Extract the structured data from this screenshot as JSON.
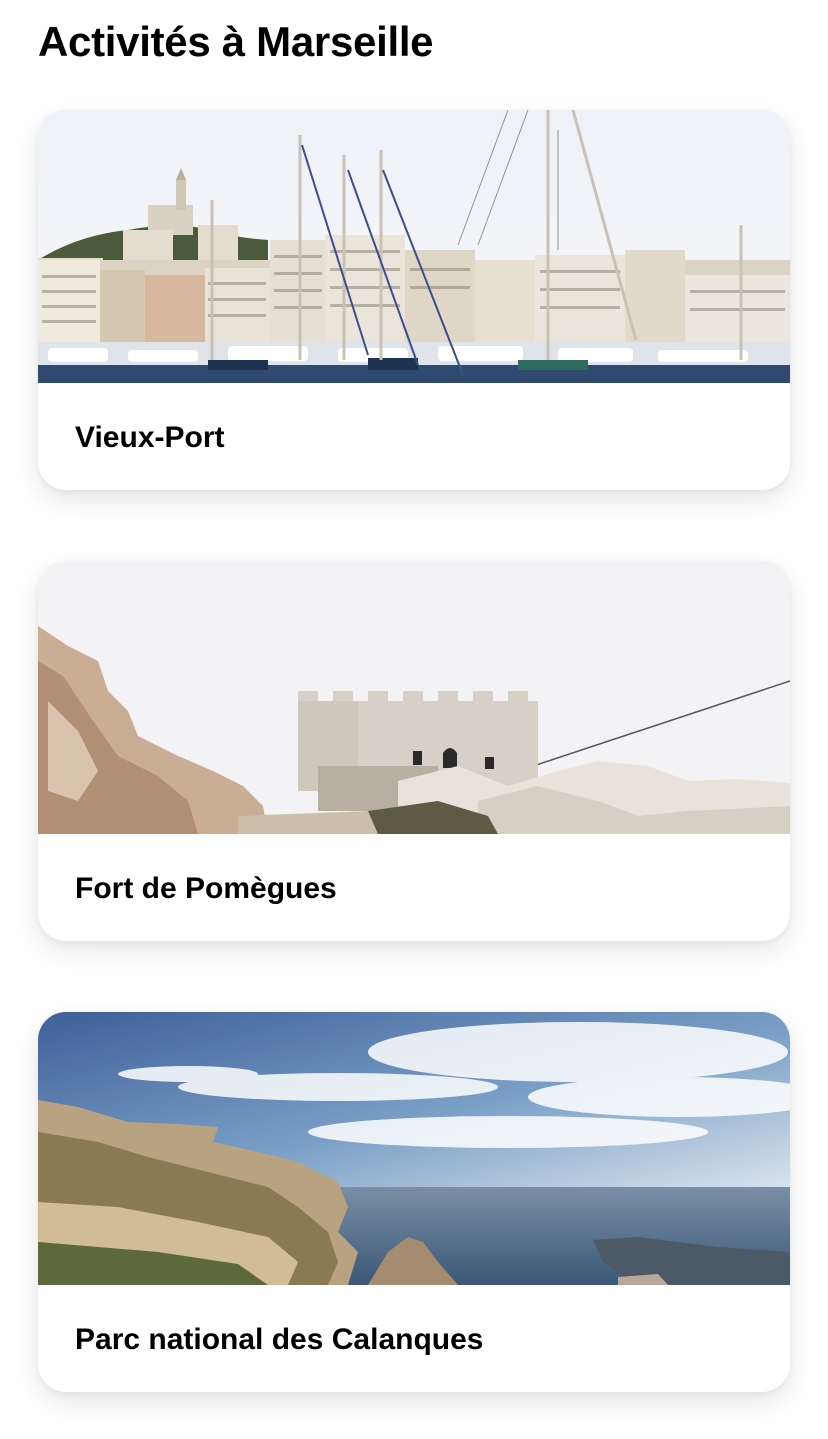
{
  "page": {
    "title": "Activités à Marseille"
  },
  "activities": [
    {
      "name": "Vieux-Port",
      "image": "harbor-photo"
    },
    {
      "name": "Fort de Pomègues",
      "image": "fortress-photo"
    },
    {
      "name": "Parc national des Calanques",
      "image": "calanques-photo"
    }
  ]
}
